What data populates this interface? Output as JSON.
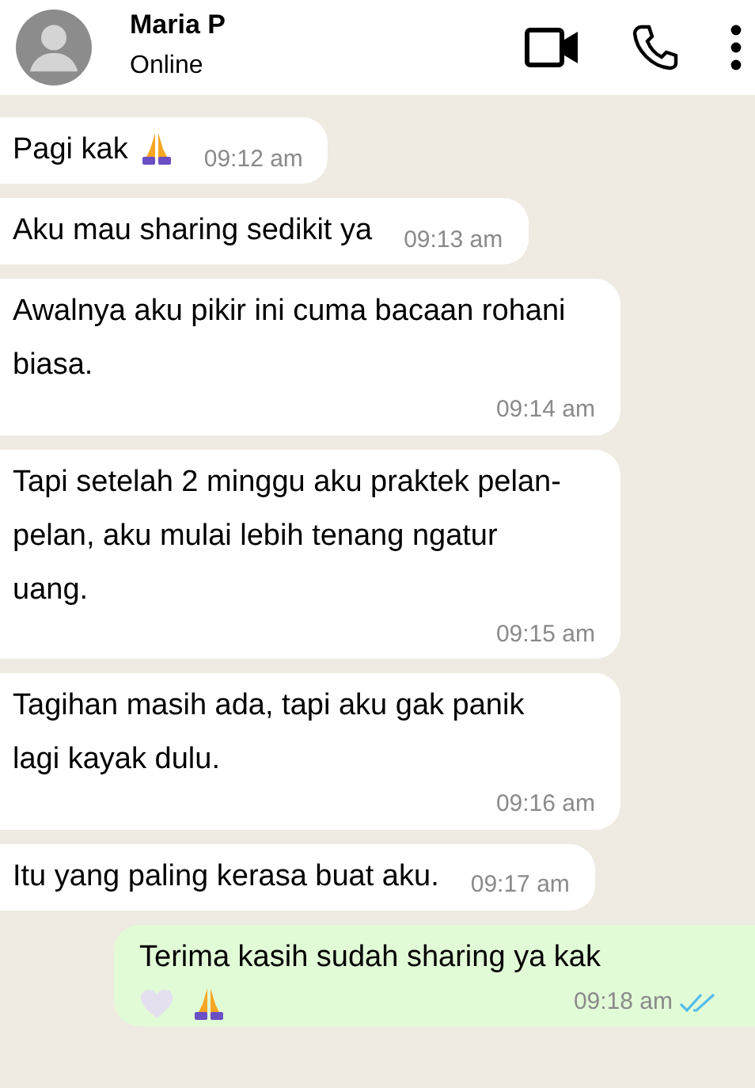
{
  "contact": {
    "name": "Maria P",
    "status": "Online"
  },
  "messages": [
    {
      "text": "Pagi kak",
      "time": "09:12 am",
      "outgoing": false,
      "kind": "with-pray"
    },
    {
      "text": "Aku mau sharing sedikit ya",
      "time": "09:13 am",
      "outgoing": false,
      "kind": "plain"
    },
    {
      "text": "Awalnya aku pikir ini cuma bacaan rohani biasa.",
      "time": "09:14 am",
      "outgoing": false,
      "kind": "plain"
    },
    {
      "text": "Tapi setelah 2 minggu aku praktek pelan-pelan, aku mulai lebih tenang ngatur uang.",
      "time": "09:15 am",
      "outgoing": false,
      "kind": "plain"
    },
    {
      "text": "Tagihan masih ada, tapi aku gak panik lagi kayak dulu.",
      "time": "09:16 am",
      "outgoing": false,
      "kind": "plain"
    },
    {
      "text": "Itu yang paling kerasa buat aku.",
      "time": "09:17 am",
      "outgoing": false,
      "kind": "plain"
    },
    {
      "text": "Terima kasih sudah sharing ya kak",
      "time": "09:18 am",
      "outgoing": true,
      "read": true,
      "kind": "with-heart-pray"
    }
  ]
}
